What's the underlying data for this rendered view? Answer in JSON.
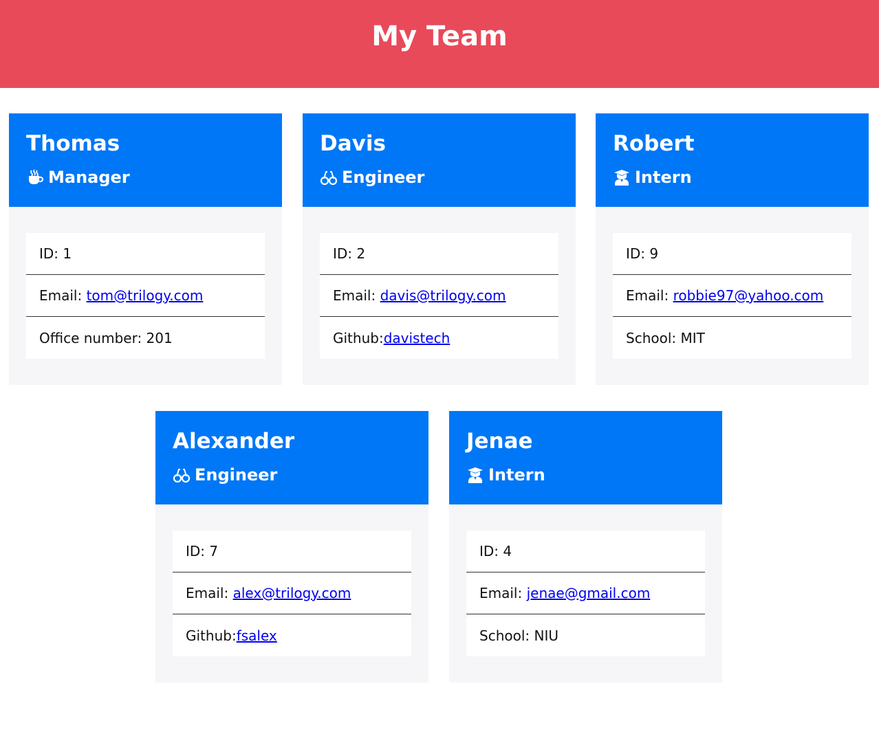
{
  "header": {
    "title": "My Team"
  },
  "cards": [
    {
      "name": "Thomas",
      "role": "Manager",
      "role_icon": "coffee-mug-icon",
      "id_label": "ID: ",
      "id": "1",
      "email_label": "Email: ",
      "email": "tom@trilogy.com",
      "extra_label": "Office number: ",
      "extra_value": "201"
    },
    {
      "name": "Davis",
      "role": "Engineer",
      "role_icon": "glasses-icon",
      "id_label": "ID: ",
      "id": "2",
      "email_label": "Email: ",
      "email": "davis@trilogy.com",
      "extra_label": "Github:",
      "extra_value": "davistech"
    },
    {
      "name": "Robert",
      "role": "Intern",
      "role_icon": "graduate-icon",
      "id_label": "ID: ",
      "id": "9",
      "email_label": "Email: ",
      "email": "robbie97@yahoo.com",
      "extra_label": "School: ",
      "extra_value": "MIT"
    },
    {
      "name": "Alexander",
      "role": "Engineer",
      "role_icon": "glasses-icon",
      "id_label": "ID: ",
      "id": "7",
      "email_label": "Email: ",
      "email": "alex@trilogy.com",
      "extra_label": "Github:",
      "extra_value": "fsalex"
    },
    {
      "name": "Jenae",
      "role": "Intern",
      "role_icon": "graduate-icon",
      "id_label": "ID: ",
      "id": "4",
      "email_label": "Email: ",
      "email": "jenae@gmail.com",
      "extra_label": "School: ",
      "extra_value": "NIU"
    }
  ],
  "colors": {
    "header_bg": "#e84a5a",
    "card_head_bg": "#0077f6",
    "card_body_bg": "#f6f6f8",
    "link": "#0000ee"
  }
}
